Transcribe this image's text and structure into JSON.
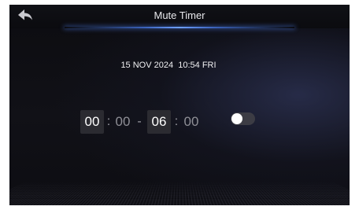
{
  "header": {
    "title": "Mute Timer",
    "back_icon": "back-arrow-icon"
  },
  "datetime": {
    "date": "15 NOV 2024",
    "time": "10:54",
    "weekday": "FRI"
  },
  "timer": {
    "start_hour": "00",
    "start_minute": "00",
    "end_hour": "06",
    "end_minute": "00",
    "colon": ":",
    "range_separator": "-"
  },
  "toggle": {
    "enabled": false
  },
  "colors": {
    "background": "#0c0c10",
    "accent_glow": "#5a8ff0",
    "active_field": "#2b2b31",
    "toggle_track": "#3c3c44"
  }
}
